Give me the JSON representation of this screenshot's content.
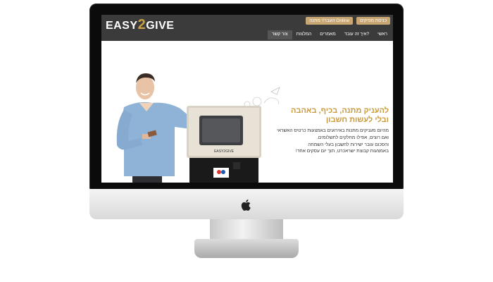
{
  "site": {
    "logo": {
      "text_prefix": "EASY",
      "text_accent": "2",
      "text_suffix": "GIVE"
    },
    "top_buttons": [
      {
        "label": "כניסת מפיקים"
      },
      {
        "label": "העבר/י מתנה Online"
      }
    ],
    "nav": [
      {
        "label": "ראשי",
        "active": false
      },
      {
        "label": "איך זה עובד?",
        "active": false
      },
      {
        "label": "מאמרים",
        "active": false
      },
      {
        "label": "המלצות",
        "active": false
      },
      {
        "label": "צור קשר",
        "active": true
      }
    ],
    "hero": {
      "headline_line1": "להעניק מתנה, בכיף, באהבה",
      "headline_line2": "ובלי לעשות חשבון",
      "body_lines": [
        "מהיום מעניקים מתנות באירועים באמצעות כרטיס האשראי",
        "ואם רוצים, אפילו מחלקים לתשלומים.",
        "והסכום עובר ישירות לחשבון בעלי השמחה",
        "באמצעות קבוצת ישראכרט, תוך יום עסקים אחד!"
      ],
      "kiosk_brand": "EASY2GIVE"
    }
  },
  "colors": {
    "accent_gold": "#c99a3d",
    "header_bg": "#3b3b3b",
    "button_bg": "#c9a772"
  }
}
